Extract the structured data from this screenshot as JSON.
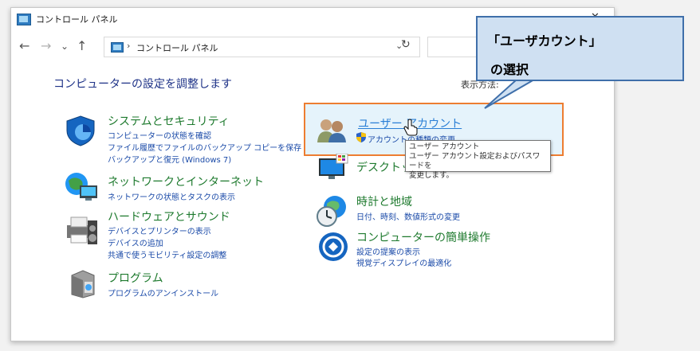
{
  "window": {
    "title": "コントロール パネル",
    "controls": {
      "minimize": "—",
      "close": "✕"
    }
  },
  "navbar": {
    "back": "←",
    "forward": "→",
    "recent": "⌄",
    "up": "↑",
    "breadcrumb_sep": "›",
    "address": "コントロール パネル",
    "dropdown": "⌄",
    "refresh": "↻"
  },
  "main": {
    "heading": "コンピューターの設定を調整します",
    "view_by": "表示方法:"
  },
  "categories_left": [
    {
      "title": "システムとセキュリティ",
      "icon": "shield-icon",
      "links": [
        "コンピューターの状態を確認",
        "ファイル履歴でファイルのバックアップ コピーを保存",
        "バックアップと復元 (Windows 7)"
      ]
    },
    {
      "title": "ネットワークとインターネット",
      "icon": "network-globe-icon",
      "links": [
        "ネットワークの状態とタスクの表示"
      ]
    },
    {
      "title": "ハードウェアとサウンド",
      "icon": "printer-speaker-icon",
      "links": [
        "デバイスとプリンターの表示",
        "デバイスの追加",
        "共通で使うモビリティ設定の調整"
      ]
    },
    {
      "title": "プログラム",
      "icon": "programs-box-icon",
      "links": [
        "プログラムのアンインストール"
      ]
    }
  ],
  "categories_right": [
    {
      "title": "ユーザー アカウント",
      "icon": "users-icon",
      "links": [
        "アカウントの種類の変更"
      ]
    },
    {
      "title": "デスクトップのカスタマイズ",
      "icon": "monitor-palette-icon",
      "links": []
    },
    {
      "title": "時計と地域",
      "icon": "clock-globe-icon",
      "links": [
        "日付、時刻、数値形式の変更"
      ]
    },
    {
      "title": "コンピューターの簡単操作",
      "icon": "accessibility-icon",
      "links": [
        "設定の提案の表示",
        "視覚ディスプレイの最適化"
      ]
    }
  ],
  "tooltip": {
    "line1": "ユーザー アカウント",
    "line2": "ユーザー アカウント設定およびパスワードを",
    "line3": "変更します。"
  },
  "callout": {
    "line1": "「ユーザカウント」",
    "line2": "の選択"
  },
  "colors": {
    "category_title": "#1e7a2e",
    "link": "#1a4aa8",
    "heading": "#1e3287",
    "highlight_border": "#ed7d31",
    "callout_fill": "#cfe0f2",
    "callout_border": "#3f6faa"
  }
}
